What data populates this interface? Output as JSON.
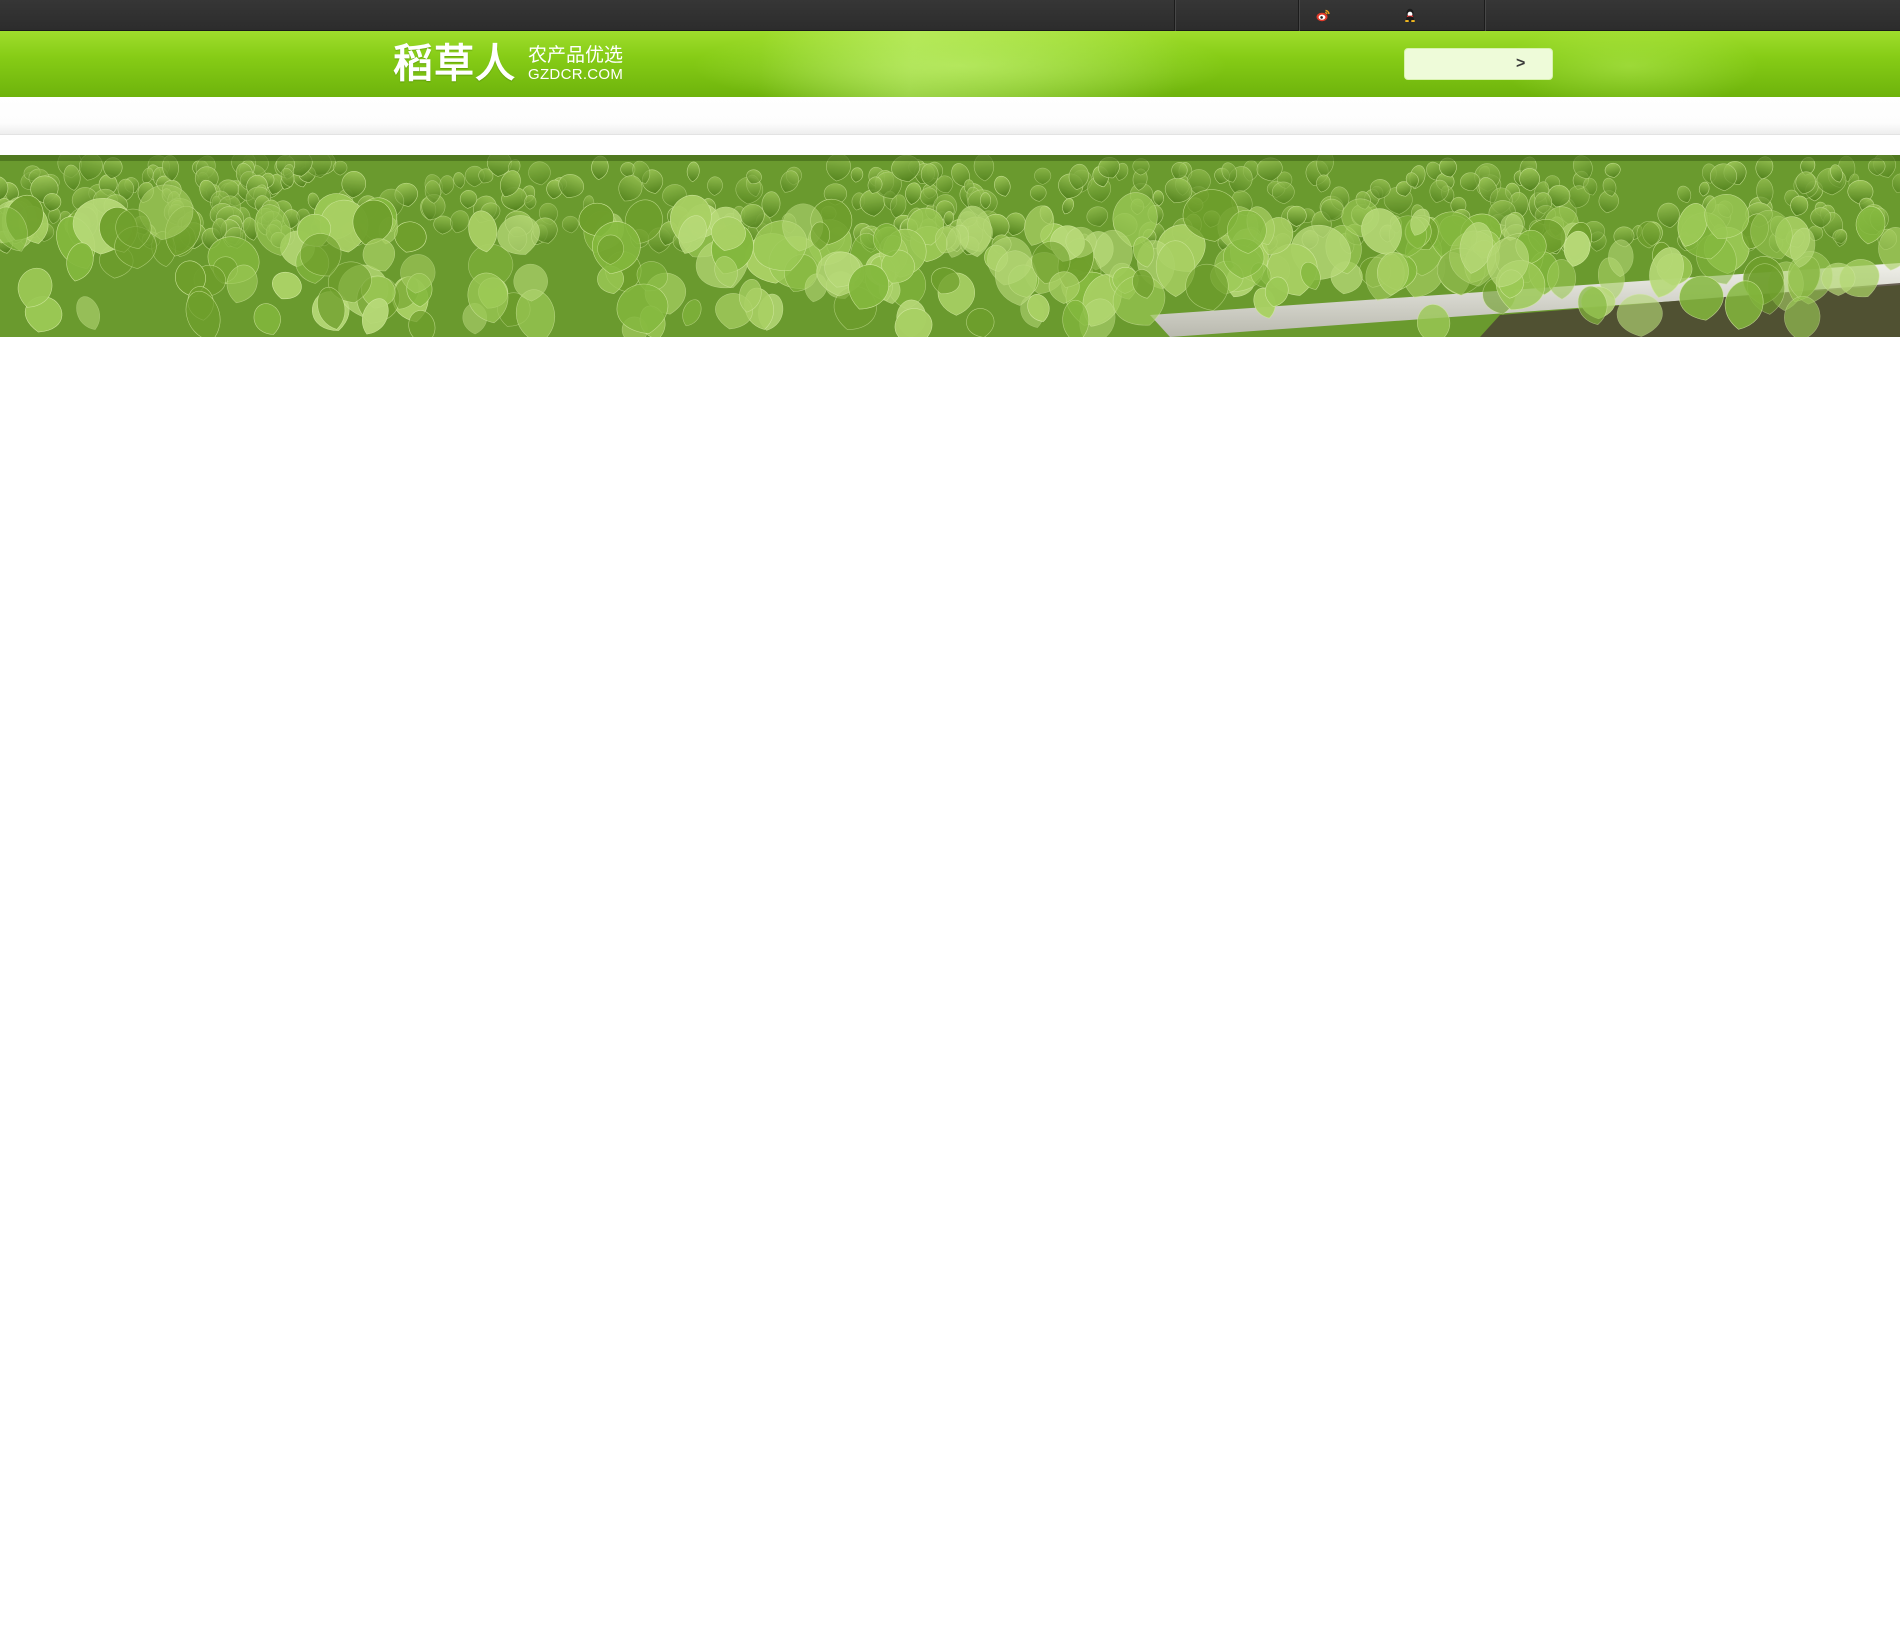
{
  "topbar": {
    "links": [
      "",
      "",
      "",
      ""
    ]
  },
  "header": {
    "logo_main": "稻草人",
    "logo_tagline": "农产品优选",
    "logo_domain": "GZDCR.COM",
    "button_arrow": ">"
  },
  "banner": {
    "image": "lettuce-field-photo"
  },
  "colors": {
    "topbar_bg": "#2f2f2f",
    "header_green": "#86cc16",
    "button_bg": "#eefbd9"
  }
}
